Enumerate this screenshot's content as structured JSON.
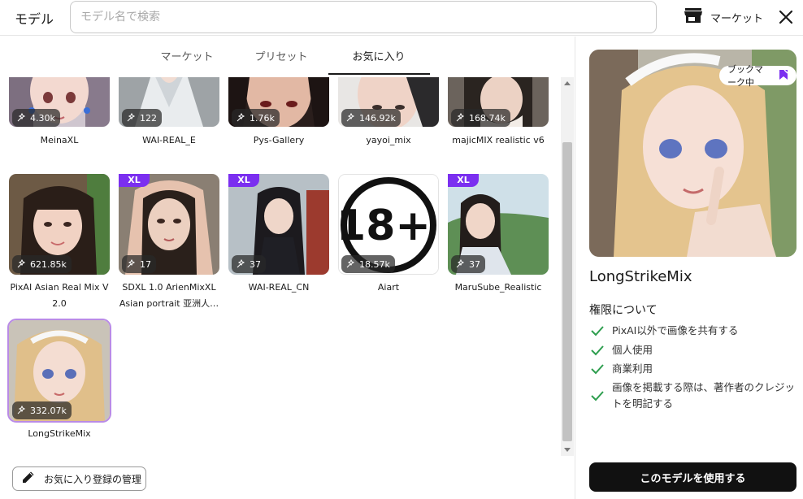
{
  "header": {
    "title": "モデル",
    "search_placeholder": "モデル名で検索",
    "market_label": "マーケット"
  },
  "tabs": [
    {
      "label": "マーケット"
    },
    {
      "label": "プリセット"
    },
    {
      "label": "お気に入り",
      "active": true
    }
  ],
  "models": [
    {
      "name": "MeinaXL",
      "count": "4.30k",
      "xl": false
    },
    {
      "name": "WAI-REAL_E",
      "count": "122",
      "xl": false
    },
    {
      "name": "Pys-Gallery",
      "count": "1.76k",
      "xl": false
    },
    {
      "name": "yayoi_mix",
      "count": "146.92k",
      "xl": false
    },
    {
      "name": "majicMIX realistic v6",
      "count": "168.74k",
      "xl": false
    },
    {
      "name_line1": "PixAI Asian Real Mix V",
      "name_line2": "2.0",
      "count": "621.85k",
      "xl": false
    },
    {
      "name_line1": "SDXL 1.0 ArienMixXL",
      "name_line2": "Asian portrait 亚洲人…",
      "count": "17",
      "xl": true,
      "xl_label": "XL"
    },
    {
      "name": "WAI-REAL_CN",
      "count": "37",
      "xl": true,
      "xl_label": "XL"
    },
    {
      "name": "Aiart",
      "count": "18.57k",
      "xl": false
    },
    {
      "name": "MaruSube_Realistic",
      "count": "37",
      "xl": true,
      "xl_label": "XL"
    },
    {
      "name": "LongStrikeMix",
      "count": "332.07k",
      "xl": false,
      "selected": true
    }
  ],
  "aiart_logo_text": "18+",
  "manage_button_label": "お気に入り登録の管理",
  "detail": {
    "bookmark_label": "ブックマーク中",
    "name": "LongStrikeMix",
    "permissions_title": "権限について",
    "permissions": [
      "PixAI以外で画像を共有する",
      "個人使用",
      "商業利用",
      "画像を掲載する際は、著作者のクレジットを明記する"
    ],
    "use_button_label": "このモデルを使用する"
  },
  "colors": {
    "accent": "#7b2ff0",
    "check": "#2e9e4f",
    "selected_border": "#b98be6"
  }
}
